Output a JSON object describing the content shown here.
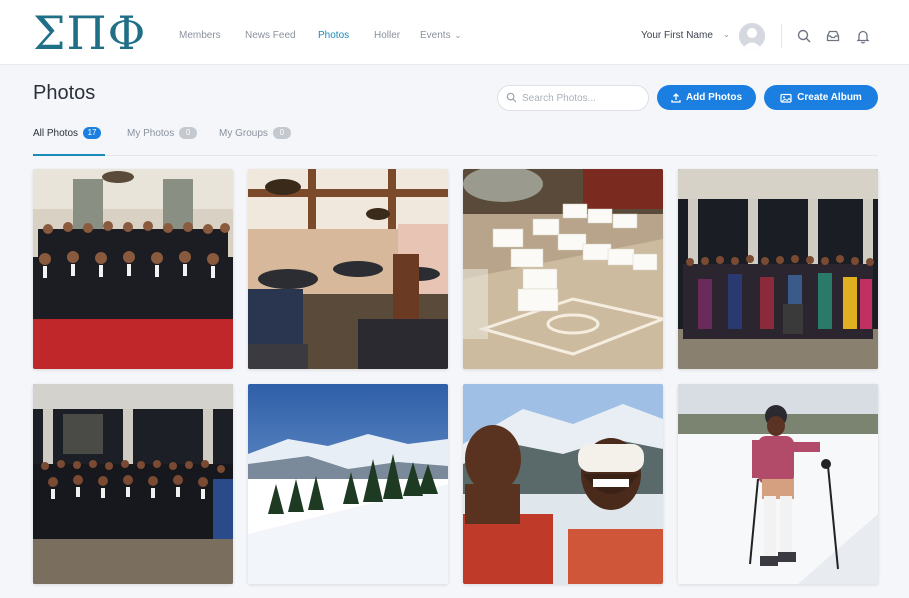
{
  "logo": {
    "text": "ΣΠΦ"
  },
  "nav": {
    "items": [
      "Members",
      "News Feed",
      "Photos",
      "Holler",
      "Events"
    ],
    "active": "Photos"
  },
  "user": {
    "name": "Your First Name"
  },
  "icons": {
    "events_dropdown": "chevron-down-icon",
    "user_dropdown": "chevron-down-icon",
    "search": "search-icon",
    "inbox": "inbox-icon",
    "notifications": "bell-icon",
    "add_photos": "upload-icon",
    "create_album": "album-icon"
  },
  "page": {
    "title": "Photos",
    "search_placeholder": "Search Photos...",
    "add_photos_label": "Add Photos",
    "create_album_label": "Create Album"
  },
  "tabs": [
    {
      "label": "All Photos",
      "count": "17",
      "active": true
    },
    {
      "label": "My Photos",
      "count": "0",
      "active": false
    },
    {
      "label": "My Groups",
      "count": "0",
      "active": false
    }
  ],
  "photos": [
    {
      "subject": "group of men in tuxedos on red carpet"
    },
    {
      "subject": "banquet hall with podium and round tables"
    },
    {
      "subject": "place cards on a table"
    },
    {
      "subject": "large group of women posing on terrace"
    },
    {
      "subject": "men in tuxedos posing on stone terrace"
    },
    {
      "subject": "snowy mountain landscape with pine trees"
    },
    {
      "subject": "couple selfie on snowy mountain"
    },
    {
      "subject": "skier in pink jacket on ski slope"
    }
  ],
  "colors": {
    "brand": "#1f6f86",
    "accent": "#1a7fe0",
    "nav_active": "#1a8ab8"
  }
}
